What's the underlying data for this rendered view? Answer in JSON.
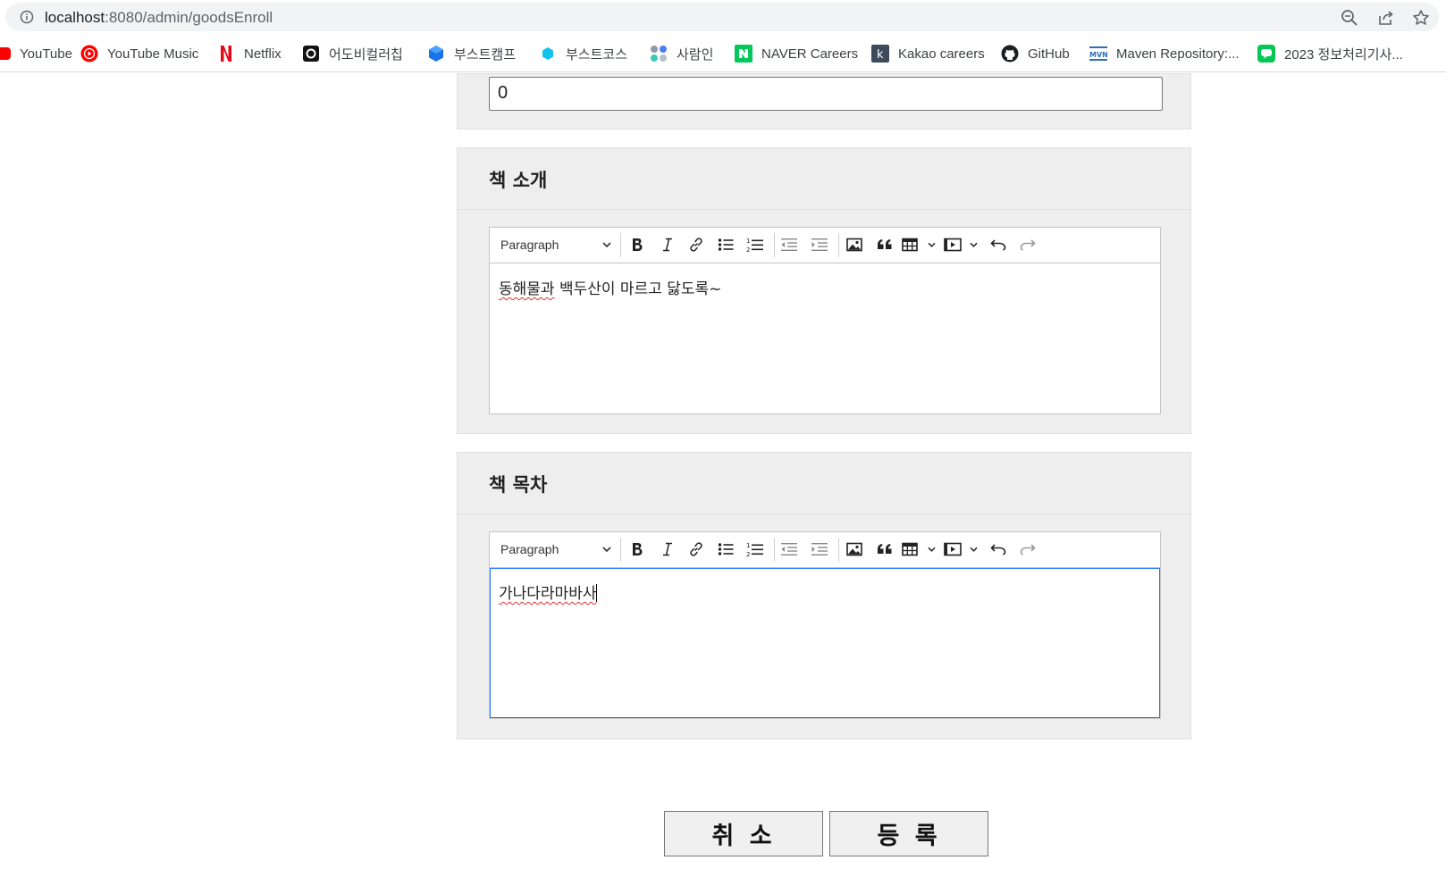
{
  "browser": {
    "url_host": "localhost",
    "url_rest": ":8080/admin/goodsEnroll",
    "icons": [
      "info-icon",
      "zoom-icon",
      "share-icon",
      "star-icon"
    ]
  },
  "bookmarks": [
    {
      "label": "YouTube",
      "icon": "youtube-icon"
    },
    {
      "label": "YouTube Music",
      "icon": "youtube-music-icon"
    },
    {
      "label": "Netflix",
      "icon": "netflix-icon"
    },
    {
      "label": "어도비컬러칩",
      "icon": "adobe-color-icon"
    },
    {
      "label": "부스트캠프",
      "icon": "boostcamp-icon"
    },
    {
      "label": "부스트코스",
      "icon": "boostcourse-icon"
    },
    {
      "label": "사람인",
      "icon": "saramin-icon"
    },
    {
      "label": "NAVER Careers",
      "icon": "naver-icon"
    },
    {
      "label": "Kakao careers",
      "icon": "kakao-icon"
    },
    {
      "label": "GitHub",
      "icon": "github-icon"
    },
    {
      "label": "Maven Repository:...",
      "icon": "maven-icon"
    },
    {
      "label": "2023 정보처리기사...",
      "icon": "line-icon"
    }
  ],
  "top_section": {
    "input_value": "0"
  },
  "intro_section": {
    "title": "책 소개",
    "paragraph_label": "Paragraph",
    "content_underlined": "동해물과",
    "content_rest": " 백두산이 마르고 닳도록~"
  },
  "toc_section": {
    "title": "책 목차",
    "paragraph_label": "Paragraph",
    "content": "가나다라마바사"
  },
  "buttons": {
    "cancel": "취 소",
    "submit": "등 록"
  },
  "colors": {
    "section_bg": "#eeeeee",
    "focus_border": "#2977ff",
    "spell_error": "#e03030"
  }
}
